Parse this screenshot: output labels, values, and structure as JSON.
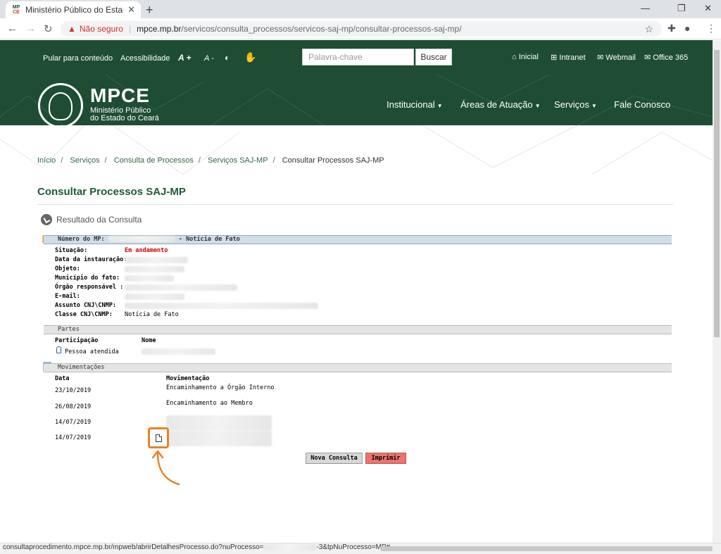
{
  "browser": {
    "tab_title": "Ministério Público do Estado do",
    "tab_favicon_top": "MP",
    "tab_favicon_bottom": "CE",
    "security_label": "Não seguro",
    "url_host": "mpce.mp.br",
    "url_path": "/servicos/consulta_processos/servicos-saj-mp/consultar-processos-saj-mp/"
  },
  "topbar": {
    "skip_link": "Pular para conteúdo",
    "accessibility": "Acessibilidade",
    "font_increase": "A +",
    "font_decrease": "A -",
    "search_placeholder": "Palavra-chave",
    "search_button": "Buscar",
    "quick_links": [
      "Inicial",
      "Intranet",
      "Webmail",
      "Office 365"
    ]
  },
  "header": {
    "logo_title": "MPCE",
    "logo_line1": "Ministério Público",
    "logo_line2": "do Estado do Ceará",
    "menu": [
      "Institucional",
      "Áreas de Atuação",
      "Serviços",
      "Fale Conosco"
    ]
  },
  "breadcrumb": [
    "Início",
    "Serviços",
    "Consulta de Processos",
    "Serviços SAJ-MP",
    "Consultar Processos SAJ-MP"
  ],
  "page_title": "Consultar Processos SAJ-MP",
  "result_title": "Resultado da Consulta",
  "process": {
    "number_label": "Número do MP:",
    "type_label": "- Notícia de Fato",
    "fields": [
      {
        "label": "Situação:",
        "value": "Em andamento"
      },
      {
        "label": "Data da instauração:",
        "value": ""
      },
      {
        "label": "Objeto:",
        "value": ""
      },
      {
        "label": "Município do fato:",
        "value": ""
      },
      {
        "label": "Órgão responsável :",
        "value": ""
      },
      {
        "label": "E-mail:",
        "value": ""
      },
      {
        "label": "Assunto CNJ\\CNMP:",
        "value": ""
      },
      {
        "label": "Classe CNJ\\CNMP:",
        "value": "Notícia de Fato"
      }
    ]
  },
  "partes": {
    "section": "Partes",
    "col_participacao": "Participação",
    "col_nome": "Nome",
    "rows": [
      {
        "participacao": "Pessoa atendida",
        "nome": ""
      }
    ]
  },
  "movimentacoes": {
    "section": "Movimentações",
    "col_data": "Data",
    "col_mov": "Movimentação",
    "rows": [
      {
        "data": "23/10/2019",
        "mov": "Encaminhamento a Órgão Interno"
      },
      {
        "data": "26/08/2019",
        "mov": "Encaminhamento ao Membro"
      },
      {
        "data": "14/07/2019",
        "mov": ""
      },
      {
        "data": "14/07/2019",
        "mov": ""
      }
    ]
  },
  "buttons": {
    "nova": "Nova Consulta",
    "imprimir": "Imprimir"
  },
  "status_bar": {
    "url_prefix": "consultaprocedimento.mpce.mp.br/mpweb/abrirDetalhesProcesso.do?nuProcesso=",
    "url_suffix": "-3&tpNuProcesso=MP#"
  },
  "colors": {
    "brand_green": "#1e4d33",
    "accent_orange": "#e8822b",
    "situacao_red": "#d40000"
  }
}
